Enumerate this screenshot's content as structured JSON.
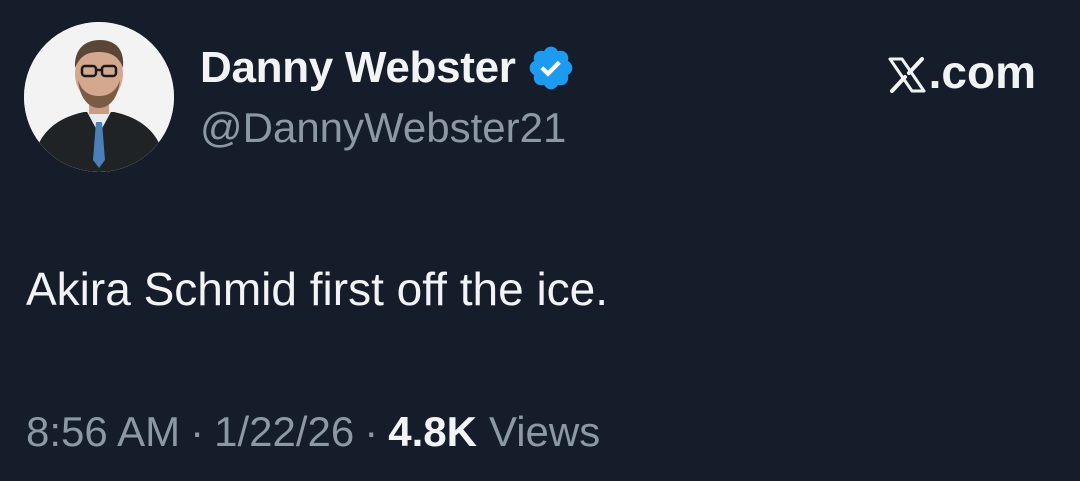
{
  "author": {
    "display_name": "Danny Webster",
    "handle": "@DannyWebster21",
    "verified_icon": "verified-badge-icon",
    "avatar": "profile-photo"
  },
  "brand": {
    "label": "𝕏.com",
    "text": ".com",
    "icon": "x-logo-icon"
  },
  "tweet": {
    "text": "Akira Schmid first off the ice."
  },
  "meta": {
    "time": "8:56 AM",
    "separator": "·",
    "date": "1/22/26",
    "views_count": "4.8K",
    "views_label": "Views"
  },
  "colors": {
    "background": "#151d2a",
    "primary_text": "#f1f3f5",
    "secondary_text": "#8b98a5",
    "verified_blue": "#1d9bf0"
  }
}
